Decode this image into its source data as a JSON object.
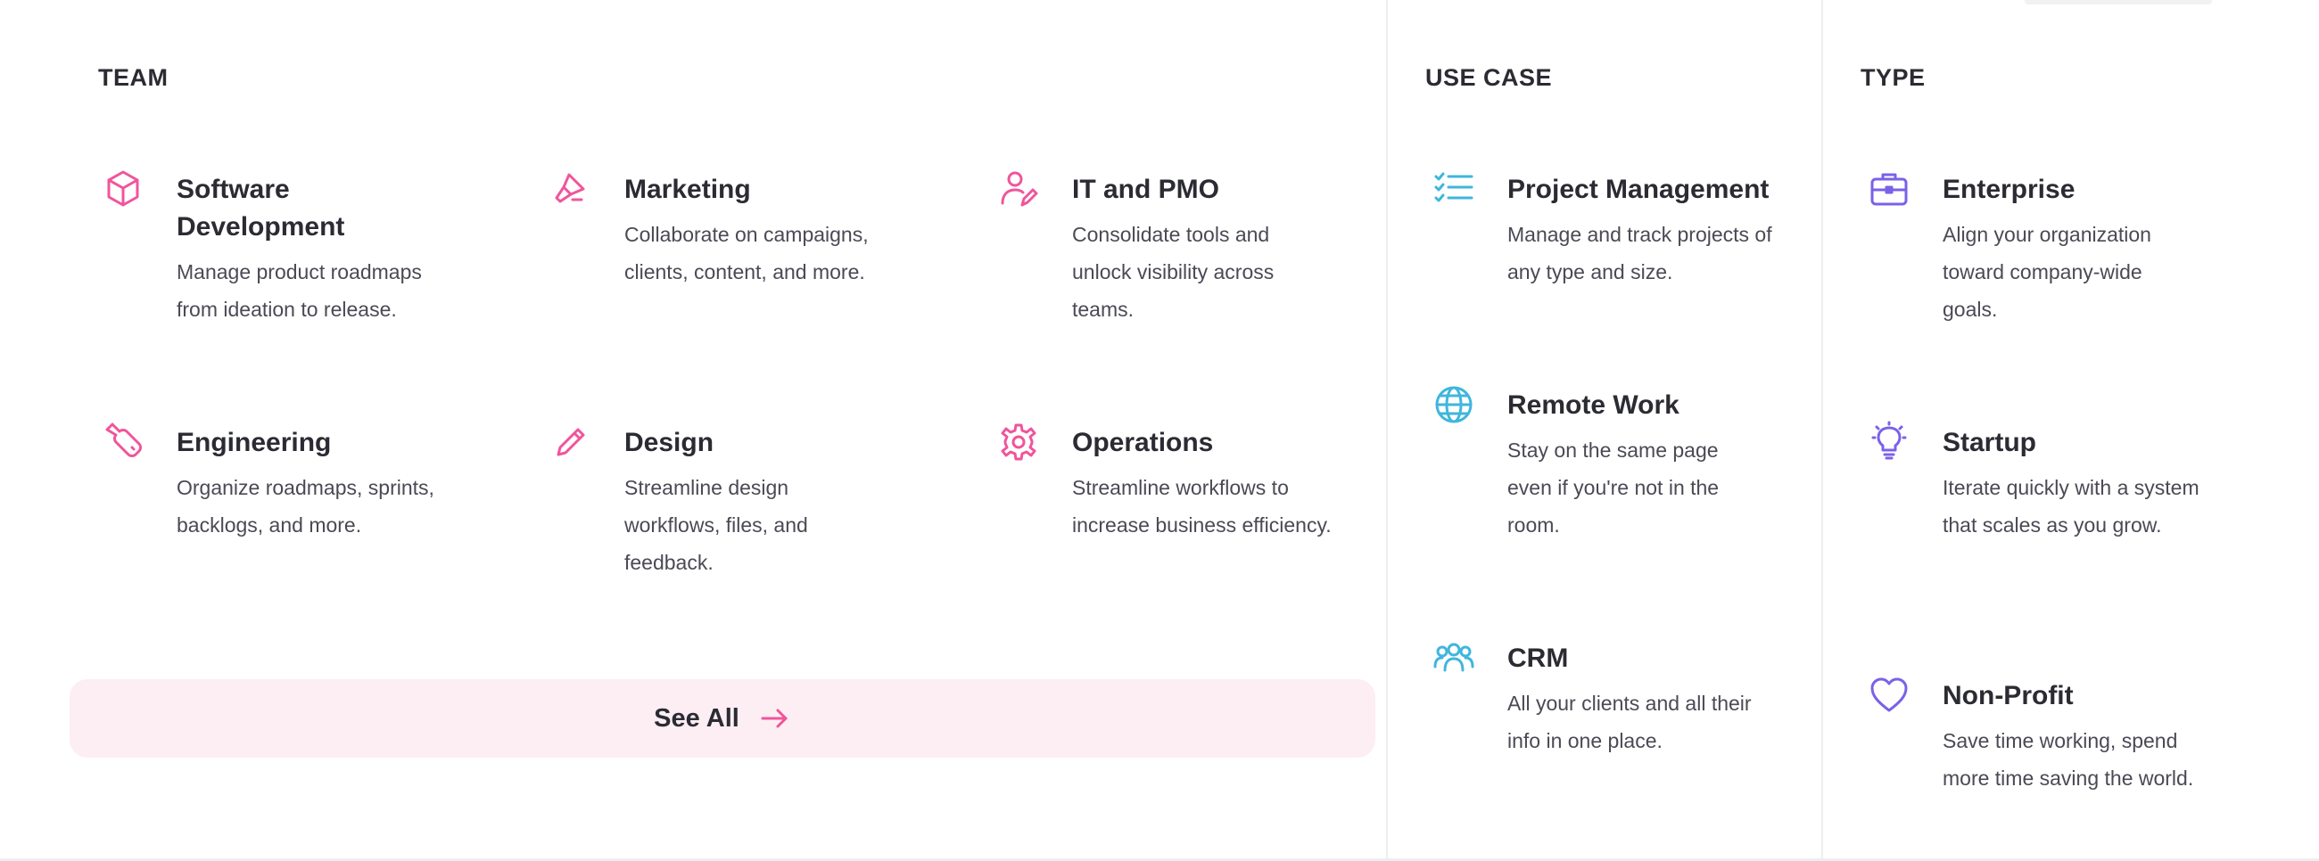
{
  "colors": {
    "team_accent": "#f0559b",
    "usecase_accent": "#3fb6dd",
    "type_accent": "#7b61e8",
    "see_all_bg": "#fdeef4"
  },
  "team": {
    "heading": "TEAM",
    "items": [
      {
        "icon": "cube-icon",
        "title": "Software Development",
        "description": "Manage product roadmaps from ideation to release."
      },
      {
        "icon": "megaphone-icon",
        "title": "Marketing",
        "description": "Collaborate on campaigns, clients, content, and more."
      },
      {
        "icon": "user-edit-icon",
        "title": "IT and PMO",
        "description": "Consolidate tools and unlock visibility across teams."
      },
      {
        "icon": "wrench-icon",
        "title": "Engineering",
        "description": "Organize roadmaps, sprints, backlogs, and more."
      },
      {
        "icon": "pencil-icon",
        "title": "Design",
        "description": "Streamline design workflows, files, and feedback."
      },
      {
        "icon": "gear-icon",
        "title": "Operations",
        "description": "Streamline workflows to increase business efficiency."
      }
    ],
    "see_all": {
      "label": "See All",
      "icon": "arrow-right-icon"
    }
  },
  "use_case": {
    "heading": "USE CASE",
    "items": [
      {
        "icon": "checklist-icon",
        "title": "Project Management",
        "description": "Manage and track projects of any type and size."
      },
      {
        "icon": "globe-icon",
        "title": "Remote Work",
        "description": "Stay on the same page even if you're not in the room."
      },
      {
        "icon": "users-icon",
        "title": "CRM",
        "description": "All your clients and all their info in one place."
      }
    ]
  },
  "type": {
    "heading": "TYPE",
    "items": [
      {
        "icon": "briefcase-icon",
        "title": "Enterprise",
        "description": "Align your organization toward company-wide goals."
      },
      {
        "icon": "lightbulb-icon",
        "title": "Startup",
        "description": "Iterate quickly with a system that scales as you grow."
      },
      {
        "icon": "heart-icon",
        "title": "Non-Profit",
        "description": "Save time working, spend more time saving the world."
      }
    ]
  }
}
